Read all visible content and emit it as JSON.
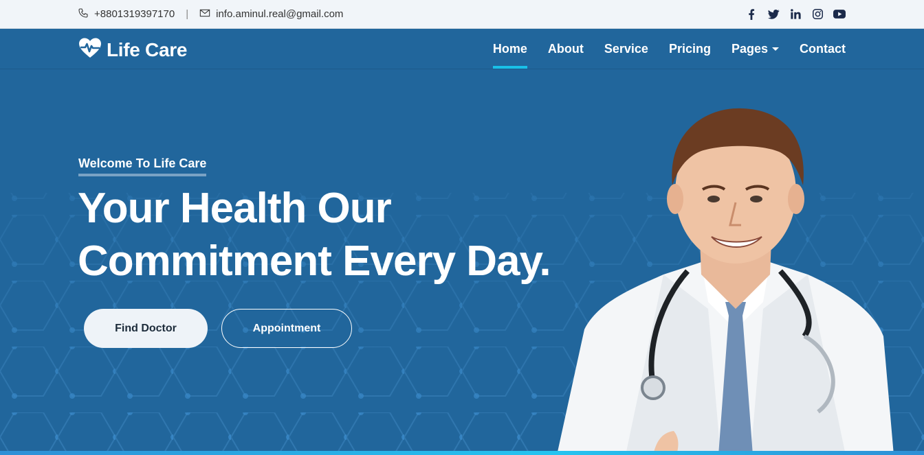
{
  "topbar": {
    "phone": "+8801319397170",
    "separator": "|",
    "email": "info.aminul.real@gmail.com",
    "social": [
      "facebook-icon",
      "twitter-icon",
      "linkedin-icon",
      "instagram-icon",
      "youtube-icon"
    ]
  },
  "brand": {
    "name": "Life Care"
  },
  "nav": {
    "items": [
      {
        "label": "Home",
        "active": true
      },
      {
        "label": "About"
      },
      {
        "label": "Service"
      },
      {
        "label": "Pricing"
      },
      {
        "label": "Pages",
        "dropdown": true
      },
      {
        "label": "Contact"
      }
    ]
  },
  "hero": {
    "kicker": "Welcome To Life Care",
    "headline_line1": "Your Health Our",
    "headline_line2": "Commitment Every Day.",
    "buttons": {
      "find_doctor": "Find Doctor",
      "appointment": "Appointment"
    }
  },
  "colors": {
    "primary": "#21669c",
    "accent": "#19c0e8",
    "light": "#f1f5f9"
  }
}
